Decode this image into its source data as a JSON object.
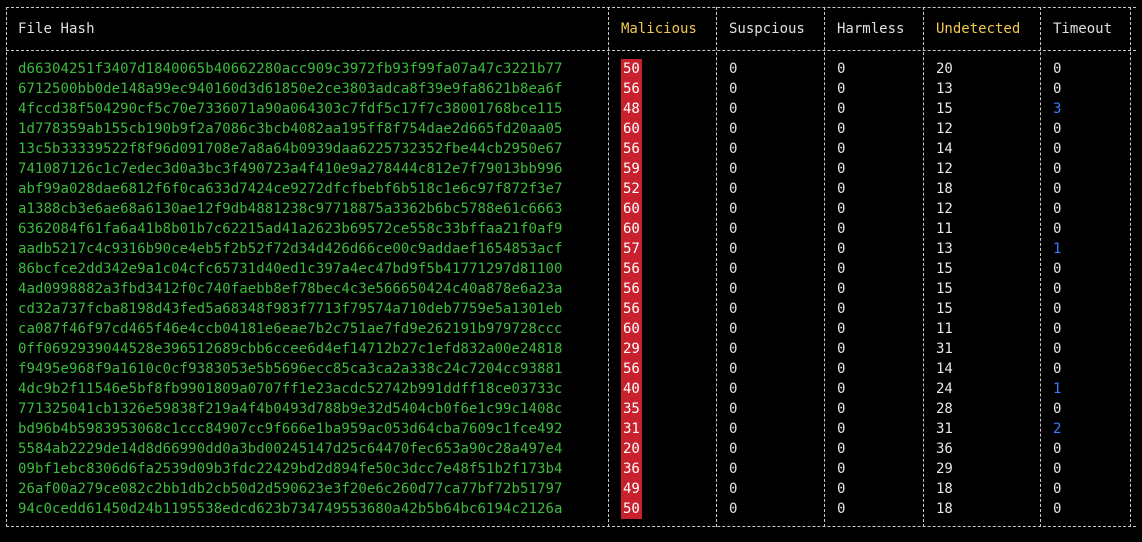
{
  "colors": {
    "background": "#000000",
    "hash_text": "#3dbb3d",
    "malicious_highlight": "#c8202c",
    "timeout_nonzero": "#3b78ff",
    "header_accent": "#f2c94c"
  },
  "table": {
    "headers": {
      "file_hash": "File Hash",
      "malicious": "Malicious",
      "suspicious": "Suspcious",
      "harmless": "Harmless",
      "undetected": "Undetected",
      "timeout": "Timeout"
    },
    "rows": [
      {
        "hash": "d66304251f3407d1840065b40662280acc909c3972fb93f99fa07a47c3221b77",
        "malicious": "50",
        "suspicious": "0",
        "harmless": "0",
        "undetected": "20",
        "timeout": "0"
      },
      {
        "hash": "6712500bb0de148a99ec940160d3d61850e2ce3803adca8f39e9fa8621b8ea6f",
        "malicious": "56",
        "suspicious": "0",
        "harmless": "0",
        "undetected": "13",
        "timeout": "0"
      },
      {
        "hash": "4fccd38f504290cf5c70e7336071a90a064303c7fdf5c17f7c38001768bce115",
        "malicious": "48",
        "suspicious": "0",
        "harmless": "0",
        "undetected": "15",
        "timeout": "3"
      },
      {
        "hash": "1d778359ab155cb190b9f2a7086c3bcb4082aa195ff8f754dae2d665fd20aa05",
        "malicious": "60",
        "suspicious": "0",
        "harmless": "0",
        "undetected": "12",
        "timeout": "0"
      },
      {
        "hash": "13c5b33339522f8f96d091708e7a8a64b0939daa6225732352fbe44cb2950e67",
        "malicious": "56",
        "suspicious": "0",
        "harmless": "0",
        "undetected": "14",
        "timeout": "0"
      },
      {
        "hash": "741087126c1c7edec3d0a3bc3f490723a4f410e9a278444c812e7f79013bb996",
        "malicious": "59",
        "suspicious": "0",
        "harmless": "0",
        "undetected": "12",
        "timeout": "0"
      },
      {
        "hash": "abf99a028dae6812f6f0ca633d7424ce9272dfcfbebf6b518c1e6c97f872f3e7",
        "malicious": "52",
        "suspicious": "0",
        "harmless": "0",
        "undetected": "18",
        "timeout": "0"
      },
      {
        "hash": "a1388cb3e6ae68a6130ae12f9db4881238c97718875a3362b6bc5788e61c6663",
        "malicious": "60",
        "suspicious": "0",
        "harmless": "0",
        "undetected": "12",
        "timeout": "0"
      },
      {
        "hash": "6362084f61fa6a41b8b01b7c62215ad41a2623b69572ce558c33bffaa21f0af9",
        "malicious": "60",
        "suspicious": "0",
        "harmless": "0",
        "undetected": "11",
        "timeout": "0"
      },
      {
        "hash": "aadb5217c4c9316b90ce4eb5f2b52f72d34d426d66ce00c9addaef1654853acf",
        "malicious": "57",
        "suspicious": "0",
        "harmless": "0",
        "undetected": "13",
        "timeout": "1"
      },
      {
        "hash": "86bcfce2dd342e9a1c04cfc65731d40ed1c397a4ec47bd9f5b41771297d81100",
        "malicious": "56",
        "suspicious": "0",
        "harmless": "0",
        "undetected": "15",
        "timeout": "0"
      },
      {
        "hash": "4ad0998882a3fbd3412f0c740faebb8ef78bec4c3e566650424c40a878e6a23a",
        "malicious": "56",
        "suspicious": "0",
        "harmless": "0",
        "undetected": "15",
        "timeout": "0"
      },
      {
        "hash": "cd32a737fcba8198d43fed5a68348f983f7713f79574a710deb7759e5a1301eb",
        "malicious": "56",
        "suspicious": "0",
        "harmless": "0",
        "undetected": "15",
        "timeout": "0"
      },
      {
        "hash": "ca087f46f97cd465f46e4ccb04181e6eae7b2c751ae7fd9e262191b979728ccc",
        "malicious": "60",
        "suspicious": "0",
        "harmless": "0",
        "undetected": "11",
        "timeout": "0"
      },
      {
        "hash": "0ff0692939044528e396512689cbb6ccee6d4ef14712b27c1efd832a00e24818",
        "malicious": "29",
        "suspicious": "0",
        "harmless": "0",
        "undetected": "31",
        "timeout": "0"
      },
      {
        "hash": "f9495e968f9a1610c0cf9383053e5b5696ecc85ca3ca2a338c24c7204cc93881",
        "malicious": "56",
        "suspicious": "0",
        "harmless": "0",
        "undetected": "14",
        "timeout": "0"
      },
      {
        "hash": "4dc9b2f11546e5bf8fb9901809a0707ff1e23acdc52742b991ddff18ce03733c",
        "malicious": "40",
        "suspicious": "0",
        "harmless": "0",
        "undetected": "24",
        "timeout": "1"
      },
      {
        "hash": "771325041cb1326e59838f219a4f4b0493d788b9e32d5404cb0f6e1c99c1408c",
        "malicious": "35",
        "suspicious": "0",
        "harmless": "0",
        "undetected": "28",
        "timeout": "0"
      },
      {
        "hash": "bd96b4b5983953068c1ccc84907cc9f666e1ba959ac053d64cba7609c1fce492",
        "malicious": "31",
        "suspicious": "0",
        "harmless": "0",
        "undetected": "31",
        "timeout": "2"
      },
      {
        "hash": "5584ab2229de14d8d66990dd0a3bd00245147d25c64470fec653a90c28a497e4",
        "malicious": "20",
        "suspicious": "0",
        "harmless": "0",
        "undetected": "36",
        "timeout": "0"
      },
      {
        "hash": "09bf1ebc8306d6fa2539d09b3fdc22429bd2d894fe50c3dcc7e48f51b2f173b4",
        "malicious": "36",
        "suspicious": "0",
        "harmless": "0",
        "undetected": "29",
        "timeout": "0"
      },
      {
        "hash": "26af00a279ce082c2bb1db2cb50d2d590623e3f20e6c260d77ca77bf72b51797",
        "malicious": "49",
        "suspicious": "0",
        "harmless": "0",
        "undetected": "18",
        "timeout": "0"
      },
      {
        "hash": "94c0cedd61450d24b1195538edcd623b734749553680a42b5b64bc6194c2126a",
        "malicious": "50",
        "suspicious": "0",
        "harmless": "0",
        "undetected": "18",
        "timeout": "0"
      }
    ]
  }
}
